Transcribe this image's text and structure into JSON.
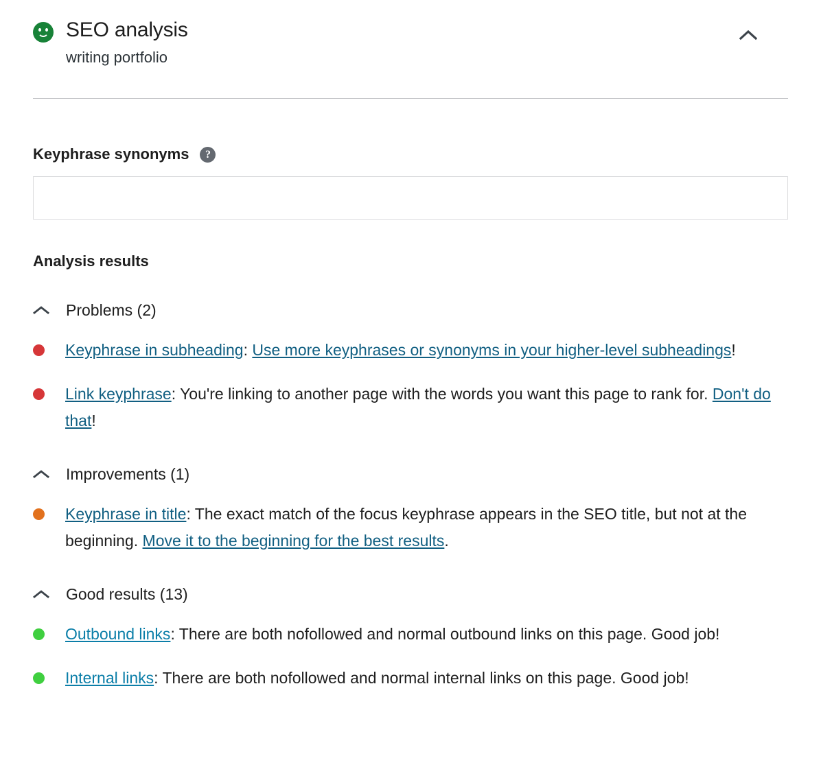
{
  "header": {
    "score_icon": "green-smiley-icon",
    "title": "SEO analysis",
    "subtitle": "writing portfolio",
    "collapse_icon": "chevron-up-icon"
  },
  "synonyms": {
    "label": "Keyphrase synonyms",
    "help_icon": "question-mark-icon",
    "help_glyph": "?",
    "value": "",
    "placeholder": ""
  },
  "results": {
    "heading": "Analysis results",
    "groups": [
      {
        "chevron_icon": "chevron-up-icon",
        "label": "Problems (2)",
        "items": [
          {
            "bullet": "bad",
            "parts": [
              {
                "type": "link",
                "text": "Keyphrase in subheading"
              },
              {
                "type": "text",
                "text": ": "
              },
              {
                "type": "link",
                "text": "Use more keyphrases or synonyms in your higher-level subheadings"
              },
              {
                "type": "text",
                "text": "!"
              }
            ]
          },
          {
            "bullet": "bad",
            "parts": [
              {
                "type": "link",
                "text": "Link keyphrase"
              },
              {
                "type": "text",
                "text": ": You're linking to another page with the words you want this page to rank for. "
              },
              {
                "type": "link",
                "text": "Don't do that"
              },
              {
                "type": "text",
                "text": "!"
              }
            ]
          }
        ]
      },
      {
        "chevron_icon": "chevron-up-icon",
        "label": "Improvements (1)",
        "items": [
          {
            "bullet": "ok",
            "parts": [
              {
                "type": "link",
                "text": "Keyphrase in title"
              },
              {
                "type": "text",
                "text": ": The exact match of the focus keyphrase appears in the SEO title, but not at the beginning. "
              },
              {
                "type": "link",
                "text": "Move it to the beginning for the best results"
              },
              {
                "type": "text",
                "text": "."
              }
            ]
          }
        ]
      },
      {
        "chevron_icon": "chevron-up-icon",
        "label": "Good results (13)",
        "items": [
          {
            "bullet": "good",
            "parts": [
              {
                "type": "link",
                "text": "Outbound links"
              },
              {
                "type": "text",
                "text": ": There are both nofollowed and normal outbound links on this page. Good job!"
              }
            ]
          },
          {
            "bullet": "good",
            "parts": [
              {
                "type": "link",
                "text": "Internal links"
              },
              {
                "type": "text",
                "text": ": There are both nofollowed and normal internal links on this page. Good job!"
              }
            ]
          }
        ]
      }
    ]
  },
  "colors": {
    "bad": "#d63638",
    "ok": "#e2711d",
    "good": "#3fcf3f",
    "score_green": "#188238",
    "link": "#115f82"
  }
}
